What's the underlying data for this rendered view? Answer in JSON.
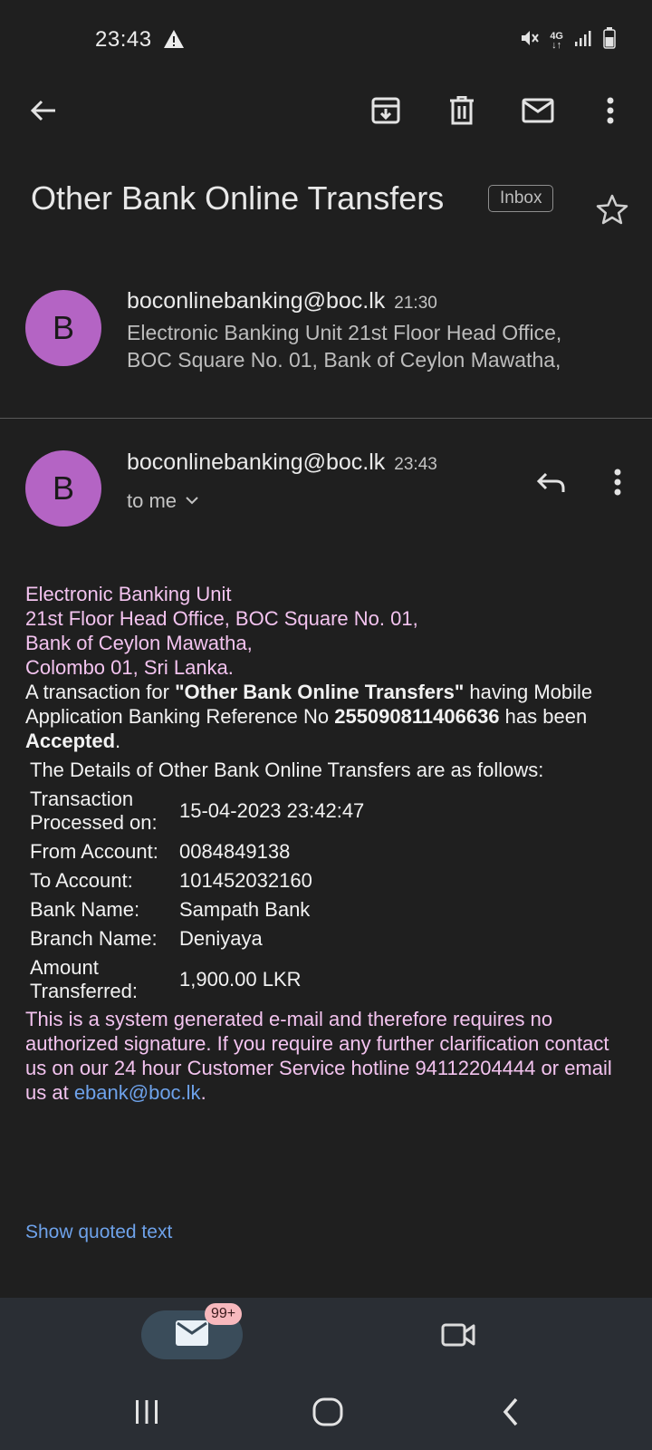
{
  "status_bar": {
    "time": "23:43",
    "network": "4G",
    "icons": [
      "warning-icon",
      "mute-icon",
      "signal-icon",
      "battery-icon"
    ]
  },
  "toolbar": {
    "icons": [
      "back-arrow-icon",
      "archive-icon",
      "delete-icon",
      "mark-unread-icon",
      "more-vert-icon"
    ]
  },
  "subject": {
    "title": "Other Bank Online Transfers",
    "label": "Inbox"
  },
  "messages": [
    {
      "avatar": "B",
      "sender": "boconlinebanking@boc.lk",
      "time": "21:30",
      "snippet_line1": "Electronic Banking Unit 21st Floor Head Office,",
      "snippet_line2": "BOC Square No. 01, Bank of Ceylon Mawatha,"
    },
    {
      "avatar": "B",
      "sender": "boconlinebanking@boc.lk",
      "time": "23:43",
      "recipient": "to me"
    }
  ],
  "email_body": {
    "address": [
      "Electronic Banking Unit",
      "21st Floor Head Office, BOC Square No. 01,",
      "Bank of Ceylon Mawatha,",
      "Colombo 01, Sri Lanka."
    ],
    "intro_1": "A transaction for ",
    "intro_bold_1": "\"Other Bank Online Transfers\"",
    "intro_2": " having Mobile Application Banking Reference No ",
    "intro_bold_2": "255090811406636",
    "intro_3": " has been ",
    "intro_bold_3": "Accepted",
    "intro_4": ".",
    "details_heading": "The Details of Other Bank Online Transfers are as follows:",
    "details": {
      "processed_label": "Transaction Processed on:",
      "processed_value": "15-04-2023 23:42:47",
      "from_label": "From Account:",
      "from_value": "0084849138",
      "to_label": "To Account:",
      "to_value": "101452032160",
      "bank_label": "Bank Name:",
      "bank_value": "Sampath Bank",
      "branch_label": "Branch Name:",
      "branch_value": "Deniyaya",
      "amount_label": "Amount Transferred:",
      "amount_value": "1,900.00 LKR"
    },
    "footer_text": "This is a system generated e-mail and therefore requires no authorized signature. If you require any further clarification contact us on our 24 hour Customer Service hotline 94112204444 or email us at ",
    "footer_link": "ebank@boc.lk",
    "footer_end": "."
  },
  "show_quoted": "Show quoted text",
  "bottom_nav": {
    "mail_badge": "99+",
    "items": [
      "mail-icon",
      "video-icon"
    ]
  },
  "system_nav": [
    "recents-icon",
    "home-icon",
    "back-icon"
  ],
  "colors": {
    "background": "#1f1f1f",
    "avatar": "#b464c4",
    "pink_text": "#f3c3ef",
    "link": "#6ea2ea",
    "badge": "#f7b8bd"
  }
}
